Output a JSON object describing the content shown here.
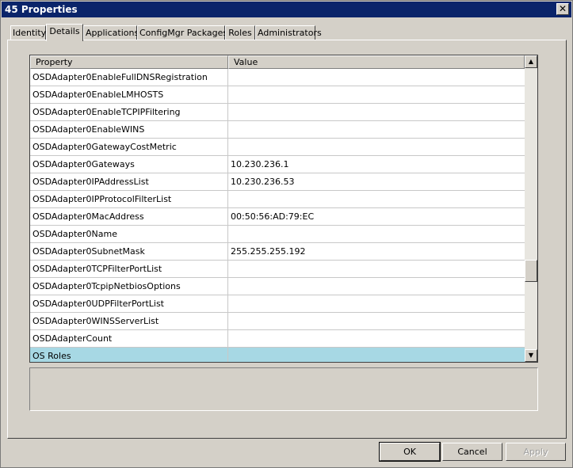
{
  "window": {
    "title": "45 Properties",
    "close_glyph": "✕"
  },
  "tabs": [
    {
      "label": "Identity"
    },
    {
      "label": "Details"
    },
    {
      "label": "Applications"
    },
    {
      "label": "ConfigMgr Packages"
    },
    {
      "label": "Roles"
    },
    {
      "label": "Administrators"
    }
  ],
  "table": {
    "columns": [
      "Property",
      "Value"
    ],
    "rows": [
      {
        "property": "OSDAdapter0EnableFullDNSRegistration",
        "value": ""
      },
      {
        "property": "OSDAdapter0EnableLMHOSTS",
        "value": ""
      },
      {
        "property": "OSDAdapter0EnableTCPIPFiltering",
        "value": ""
      },
      {
        "property": "OSDAdapter0EnableWINS",
        "value": ""
      },
      {
        "property": "OSDAdapter0GatewayCostMetric",
        "value": ""
      },
      {
        "property": "OSDAdapter0Gateways",
        "value": "10.230.236.1"
      },
      {
        "property": "OSDAdapter0IPAddressList",
        "value": "10.230.236.53"
      },
      {
        "property": "OSDAdapter0IPProtocolFilterList",
        "value": ""
      },
      {
        "property": "OSDAdapter0MacAddress",
        "value": "00:50:56:AD:79:EC"
      },
      {
        "property": "OSDAdapter0Name",
        "value": ""
      },
      {
        "property": "OSDAdapter0SubnetMask",
        "value": "255.255.255.192"
      },
      {
        "property": "OSDAdapter0TCPFilterPortList",
        "value": ""
      },
      {
        "property": "OSDAdapter0TcpipNetbiosOptions",
        "value": ""
      },
      {
        "property": "OSDAdapter0UDPFilterPortList",
        "value": ""
      },
      {
        "property": "OSDAdapter0WINSServerList",
        "value": ""
      },
      {
        "property": "OSDAdapterCount",
        "value": ""
      },
      {
        "property": "OS Roles",
        "value": "",
        "selected": true
      }
    ]
  },
  "scrollbar": {
    "up_glyph": "▲",
    "down_glyph": "▼"
  },
  "buttons": {
    "ok": "OK",
    "cancel": "Cancel",
    "apply": "Apply"
  },
  "colors": {
    "titlebar": "#0a246a",
    "selection": "#a7d8e4",
    "face": "#d4d0c8"
  }
}
